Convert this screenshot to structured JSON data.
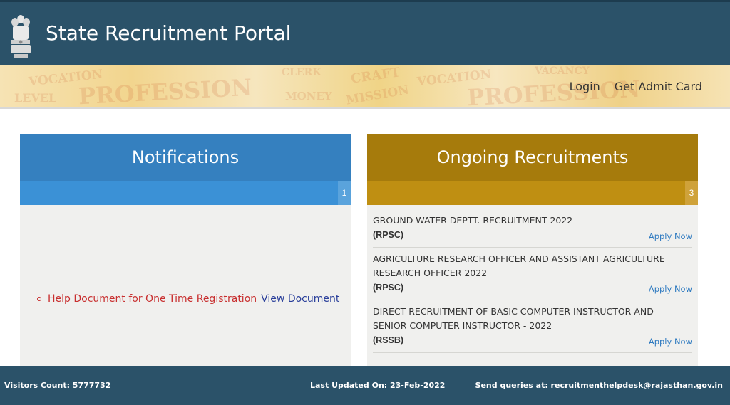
{
  "header": {
    "title": "State Recruitment Portal",
    "emblem_icon": "national-emblem-icon"
  },
  "banner": {
    "words": [
      "VOCATION",
      "PROFESSION",
      "LEVEL",
      "CLERK",
      "MONEY",
      "CRAFT",
      "MISSION",
      "VACANCY"
    ],
    "nav": [
      {
        "label": "Login"
      },
      {
        "label": "Get Admit Card"
      }
    ]
  },
  "notifications": {
    "title": "Notifications",
    "count": "1",
    "items": [
      {
        "text": "Help Document for One Time Registration",
        "link": "View Document"
      }
    ]
  },
  "recruitments": {
    "title": "Ongoing Recruitments",
    "count": "3",
    "items": [
      {
        "title": "GROUND WATER DEPTT. RECRUITMENT 2022",
        "org": "(RPSC)",
        "action": "Apply Now"
      },
      {
        "title": "AGRICULTURE RESEARCH OFFICER AND ASSISTANT AGRICULTURE RESEARCH OFFICER 2022",
        "org": "(RPSC)",
        "action": "Apply Now"
      },
      {
        "title": "DIRECT RECRUITMENT OF BASIC COMPUTER INSTRUCTOR AND SENIOR COMPUTER INSTRUCTOR - 2022",
        "org": "(RSSB)",
        "action": "Apply Now"
      }
    ]
  },
  "footer": {
    "visitors": "Visitors Count: 5777732",
    "updated": "Last Updated On: 23-Feb-2022",
    "queries": "Send queries at: recruitmenthelpdesk@rajasthan.gov.in"
  },
  "colors": {
    "header_bg": "#2b5269",
    "notifications_head": "#3580bf",
    "recruitments_head": "#a67b0c",
    "apply_link": "#2e7ac0",
    "notice_text": "#c82f2f"
  }
}
